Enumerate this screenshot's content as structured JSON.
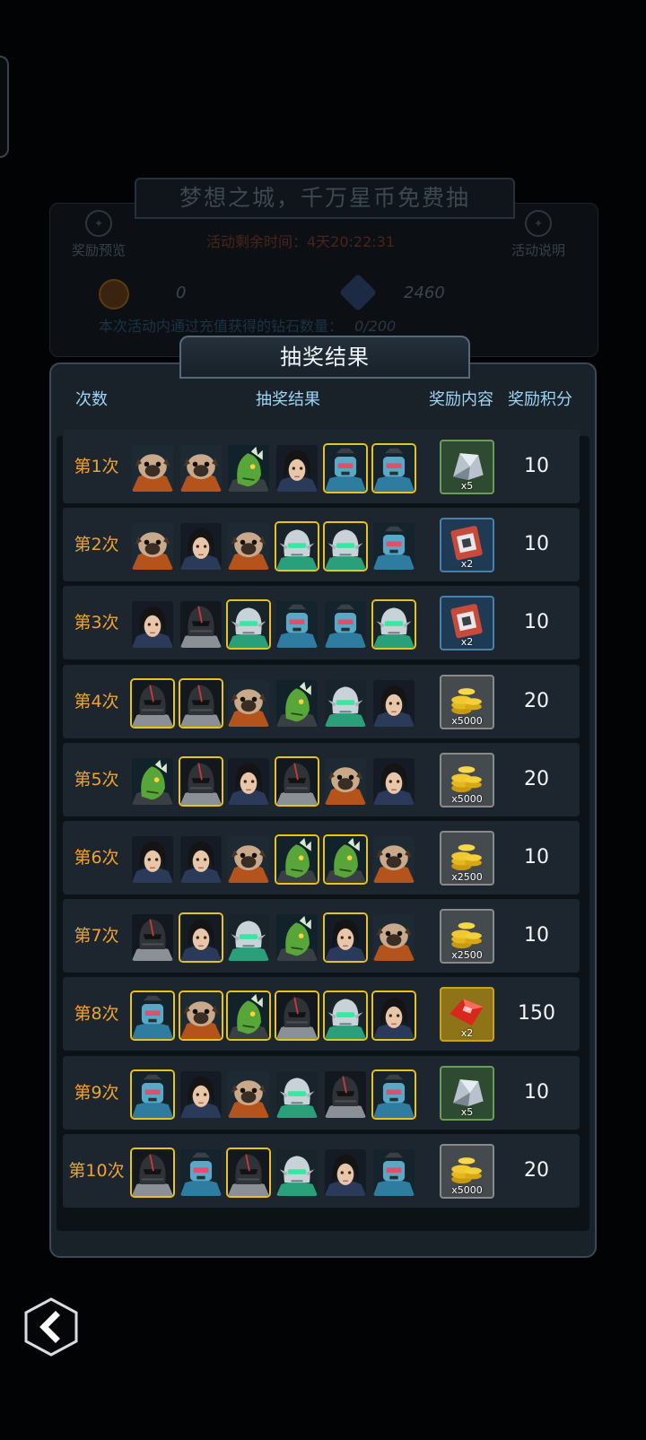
{
  "background_panel": {
    "title": "梦想之城，千万星币免费抽",
    "reward_preview_label": "奖励预览",
    "event_info_label": "活动说明",
    "timer_text": "活动剩余时间：4天20:22:31",
    "coin_value": "0",
    "diamond_value": "2460",
    "recharge_note": "本次活动内通过充值获得的钻石数量：",
    "recharge_progress": "0/200"
  },
  "dialog": {
    "title": "抽奖结果",
    "headers": {
      "count": "次数",
      "result": "抽奖结果",
      "reward": "奖励内容",
      "points": "奖励积分"
    },
    "rows": [
      {
        "label": "第1次",
        "portraits": [
          "pug",
          "pug",
          "lizard",
          "girl",
          "robot",
          "robot"
        ],
        "highlighted": [
          false,
          false,
          false,
          false,
          true,
          true
        ],
        "reward": {
          "type": "crystal",
          "qty": "x5"
        },
        "points": "10"
      },
      {
        "label": "第2次",
        "portraits": [
          "pug",
          "girl",
          "pug",
          "elf",
          "elf",
          "robot"
        ],
        "highlighted": [
          false,
          false,
          false,
          true,
          true,
          false
        ],
        "reward": {
          "type": "chip",
          "qty": "x2"
        },
        "points": "10"
      },
      {
        "label": "第3次",
        "portraits": [
          "girl",
          "knight",
          "elf",
          "robot",
          "robot",
          "elf"
        ],
        "highlighted": [
          false,
          false,
          true,
          false,
          false,
          true
        ],
        "reward": {
          "type": "chip",
          "qty": "x2"
        },
        "points": "10"
      },
      {
        "label": "第4次",
        "portraits": [
          "knight",
          "knight",
          "pug",
          "lizard",
          "elf",
          "girl"
        ],
        "highlighted": [
          true,
          true,
          false,
          false,
          false,
          false
        ],
        "reward": {
          "type": "coins",
          "qty": "x5000"
        },
        "points": "20"
      },
      {
        "label": "第5次",
        "portraits": [
          "lizard",
          "knight",
          "girl",
          "knight",
          "pug",
          "girl"
        ],
        "highlighted": [
          false,
          true,
          false,
          true,
          false,
          false
        ],
        "reward": {
          "type": "coins",
          "qty": "x5000"
        },
        "points": "20"
      },
      {
        "label": "第6次",
        "portraits": [
          "girl",
          "girl",
          "pug",
          "lizard",
          "lizard",
          "pug"
        ],
        "highlighted": [
          false,
          false,
          false,
          true,
          true,
          false
        ],
        "reward": {
          "type": "coins",
          "qty": "x2500"
        },
        "points": "10"
      },
      {
        "label": "第7次",
        "portraits": [
          "knight",
          "girl",
          "elf",
          "lizard",
          "girl",
          "pug"
        ],
        "highlighted": [
          false,
          true,
          false,
          false,
          true,
          false
        ],
        "reward": {
          "type": "coins",
          "qty": "x2500"
        },
        "points": "10"
      },
      {
        "label": "第8次",
        "portraits": [
          "robot",
          "pug",
          "lizard",
          "knight",
          "elf",
          "girl"
        ],
        "highlighted": [
          true,
          true,
          true,
          true,
          true,
          true
        ],
        "reward": {
          "type": "gem",
          "qty": "x2"
        },
        "points": "150"
      },
      {
        "label": "第9次",
        "portraits": [
          "robot",
          "girl",
          "pug",
          "elf",
          "knight",
          "robot"
        ],
        "highlighted": [
          true,
          false,
          false,
          false,
          false,
          true
        ],
        "reward": {
          "type": "crystal",
          "qty": "x5"
        },
        "points": "10"
      },
      {
        "label": "第10次",
        "portraits": [
          "knight",
          "robot",
          "knight",
          "elf",
          "girl",
          "robot"
        ],
        "highlighted": [
          true,
          false,
          true,
          false,
          false,
          false
        ],
        "reward": {
          "type": "coins",
          "qty": "x5000"
        },
        "points": "20"
      }
    ]
  },
  "icons": {
    "back": "chevron-left-icon",
    "coin": "hex-coin-icon",
    "diamond": "diamond-icon"
  },
  "colors": {
    "highlight": "#e8c416",
    "row_label": "#f0a232",
    "header": "#9ed3f6"
  }
}
